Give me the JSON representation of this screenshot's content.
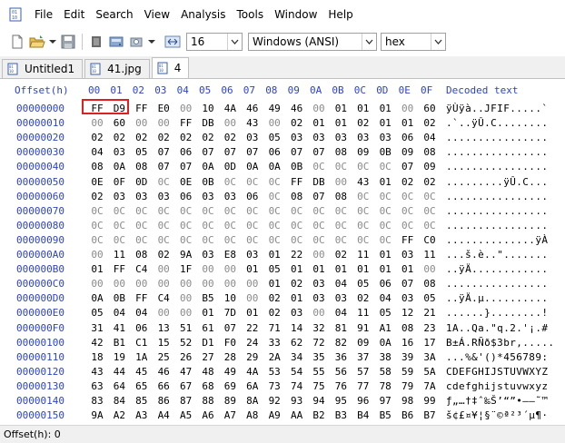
{
  "menubar": {
    "items": [
      "File",
      "Edit",
      "Search",
      "View",
      "Analysis",
      "Tools",
      "Window",
      "Help"
    ]
  },
  "toolbar": {
    "bytes_per_row": "16",
    "charset": "Windows (ANSI)",
    "display_mode": "hex",
    "icons": [
      "new-file-icon",
      "open-file-icon",
      "save-icon",
      "print-icon",
      "ram-icon",
      "disk-icon",
      "dropdown-icon",
      "width-icon"
    ]
  },
  "tabs": [
    {
      "label": "Untitled1",
      "active": false
    },
    {
      "label": "41.jpg",
      "active": false
    },
    {
      "label": "4",
      "active": true
    }
  ],
  "hex_view": {
    "offset_header": "Offset(h)",
    "column_headers": [
      "00",
      "01",
      "02",
      "03",
      "04",
      "05",
      "06",
      "07",
      "08",
      "09",
      "0A",
      "0B",
      "0C",
      "0D",
      "0E",
      "0F"
    ],
    "decoded_header": "Decoded text",
    "rows": [
      {
        "offset": "00000000",
        "bytes": [
          "FF",
          "D9",
          "FF",
          "E0",
          "00",
          "10",
          "4A",
          "46",
          "49",
          "46",
          "00",
          "01",
          "01",
          "01",
          "00",
          "60"
        ],
        "decoded": "ÿÙÿà..JFIF.....`"
      },
      {
        "offset": "00000010",
        "bytes": [
          "00",
          "60",
          "00",
          "00",
          "FF",
          "DB",
          "00",
          "43",
          "00",
          "02",
          "01",
          "01",
          "02",
          "01",
          "01",
          "02"
        ],
        "decoded": ".`..ÿÛ.C........"
      },
      {
        "offset": "00000020",
        "bytes": [
          "02",
          "02",
          "02",
          "02",
          "02",
          "02",
          "02",
          "03",
          "05",
          "03",
          "03",
          "03",
          "03",
          "03",
          "06",
          "04"
        ],
        "decoded": "................"
      },
      {
        "offset": "00000030",
        "bytes": [
          "04",
          "03",
          "05",
          "07",
          "06",
          "07",
          "07",
          "07",
          "06",
          "07",
          "07",
          "08",
          "09",
          "0B",
          "09",
          "08"
        ],
        "decoded": "................"
      },
      {
        "offset": "00000040",
        "bytes": [
          "08",
          "0A",
          "08",
          "07",
          "07",
          "0A",
          "0D",
          "0A",
          "0A",
          "0B",
          "0C",
          "0C",
          "0C",
          "0C",
          "07",
          "09"
        ],
        "decoded": "................"
      },
      {
        "offset": "00000050",
        "bytes": [
          "0E",
          "0F",
          "0D",
          "0C",
          "0E",
          "0B",
          "0C",
          "0C",
          "0C",
          "FF",
          "DB",
          "00",
          "43",
          "01",
          "02",
          "02"
        ],
        "decoded": ".........ÿÛ.C..."
      },
      {
        "offset": "00000060",
        "bytes": [
          "02",
          "03",
          "03",
          "03",
          "06",
          "03",
          "03",
          "06",
          "0C",
          "08",
          "07",
          "08",
          "0C",
          "0C",
          "0C",
          "0C"
        ],
        "decoded": "................"
      },
      {
        "offset": "00000070",
        "bytes": [
          "0C",
          "0C",
          "0C",
          "0C",
          "0C",
          "0C",
          "0C",
          "0C",
          "0C",
          "0C",
          "0C",
          "0C",
          "0C",
          "0C",
          "0C",
          "0C"
        ],
        "decoded": "................"
      },
      {
        "offset": "00000080",
        "bytes": [
          "0C",
          "0C",
          "0C",
          "0C",
          "0C",
          "0C",
          "0C",
          "0C",
          "0C",
          "0C",
          "0C",
          "0C",
          "0C",
          "0C",
          "0C",
          "0C"
        ],
        "decoded": "................"
      },
      {
        "offset": "00000090",
        "bytes": [
          "0C",
          "0C",
          "0C",
          "0C",
          "0C",
          "0C",
          "0C",
          "0C",
          "0C",
          "0C",
          "0C",
          "0C",
          "0C",
          "0C",
          "FF",
          "C0"
        ],
        "decoded": "..............ÿÀ"
      },
      {
        "offset": "000000A0",
        "bytes": [
          "00",
          "11",
          "08",
          "02",
          "9A",
          "03",
          "E8",
          "03",
          "01",
          "22",
          "00",
          "02",
          "11",
          "01",
          "03",
          "11"
        ],
        "decoded": "...š.è..\"......."
      },
      {
        "offset": "000000B0",
        "bytes": [
          "01",
          "FF",
          "C4",
          "00",
          "1F",
          "00",
          "00",
          "01",
          "05",
          "01",
          "01",
          "01",
          "01",
          "01",
          "01",
          "00"
        ],
        "decoded": "..ÿÄ............"
      },
      {
        "offset": "000000C0",
        "bytes": [
          "00",
          "00",
          "00",
          "00",
          "00",
          "00",
          "00",
          "00",
          "01",
          "02",
          "03",
          "04",
          "05",
          "06",
          "07",
          "08"
        ],
        "decoded": "................"
      },
      {
        "offset": "000000D0",
        "bytes": [
          "0A",
          "0B",
          "FF",
          "C4",
          "00",
          "B5",
          "10",
          "00",
          "02",
          "01",
          "03",
          "03",
          "02",
          "04",
          "03",
          "05"
        ],
        "decoded": "..ÿÄ.µ.........."
      },
      {
        "offset": "000000E0",
        "bytes": [
          "05",
          "04",
          "04",
          "00",
          "00",
          "01",
          "7D",
          "01",
          "02",
          "03",
          "00",
          "04",
          "11",
          "05",
          "12",
          "21"
        ],
        "decoded": "......}........!"
      },
      {
        "offset": "000000F0",
        "bytes": [
          "31",
          "41",
          "06",
          "13",
          "51",
          "61",
          "07",
          "22",
          "71",
          "14",
          "32",
          "81",
          "91",
          "A1",
          "08",
          "23"
        ],
        "decoded": "1A..Qa.\"q.2.'¡.#"
      },
      {
        "offset": "00000100",
        "bytes": [
          "42",
          "B1",
          "C1",
          "15",
          "52",
          "D1",
          "F0",
          "24",
          "33",
          "62",
          "72",
          "82",
          "09",
          "0A",
          "16",
          "17"
        ],
        "decoded": "B±Á.RÑð$3br,....."
      },
      {
        "offset": "00000110",
        "bytes": [
          "18",
          "19",
          "1A",
          "25",
          "26",
          "27",
          "28",
          "29",
          "2A",
          "34",
          "35",
          "36",
          "37",
          "38",
          "39",
          "3A"
        ],
        "decoded": "...%&'()*456789:"
      },
      {
        "offset": "00000120",
        "bytes": [
          "43",
          "44",
          "45",
          "46",
          "47",
          "48",
          "49",
          "4A",
          "53",
          "54",
          "55",
          "56",
          "57",
          "58",
          "59",
          "5A"
        ],
        "decoded": "CDEFGHIJSTUVWXYZ"
      },
      {
        "offset": "00000130",
        "bytes": [
          "63",
          "64",
          "65",
          "66",
          "67",
          "68",
          "69",
          "6A",
          "73",
          "74",
          "75",
          "76",
          "77",
          "78",
          "79",
          "7A"
        ],
        "decoded": "cdefghijstuvwxyz"
      },
      {
        "offset": "00000140",
        "bytes": [
          "83",
          "84",
          "85",
          "86",
          "87",
          "88",
          "89",
          "8A",
          "92",
          "93",
          "94",
          "95",
          "96",
          "97",
          "98",
          "99"
        ],
        "decoded": "ƒ„…†‡ˆ‰Š’“”•–—˜™"
      },
      {
        "offset": "00000150",
        "bytes": [
          "9A",
          "A2",
          "A3",
          "A4",
          "A5",
          "A6",
          "A7",
          "A8",
          "A9",
          "AA",
          "B2",
          "B3",
          "B4",
          "B5",
          "B6",
          "B7"
        ],
        "decoded": "š¢£¤¥¦§¨©ª²³´µ¶·"
      }
    ],
    "selected_bytes": [
      "FF",
      "D9"
    ]
  },
  "status": {
    "offset_label": "Offset(h): 0"
  },
  "colors": {
    "header_blue": "#2d43c8",
    "selection_border": "#e02020",
    "dim_byte": "#8a8a8a"
  }
}
